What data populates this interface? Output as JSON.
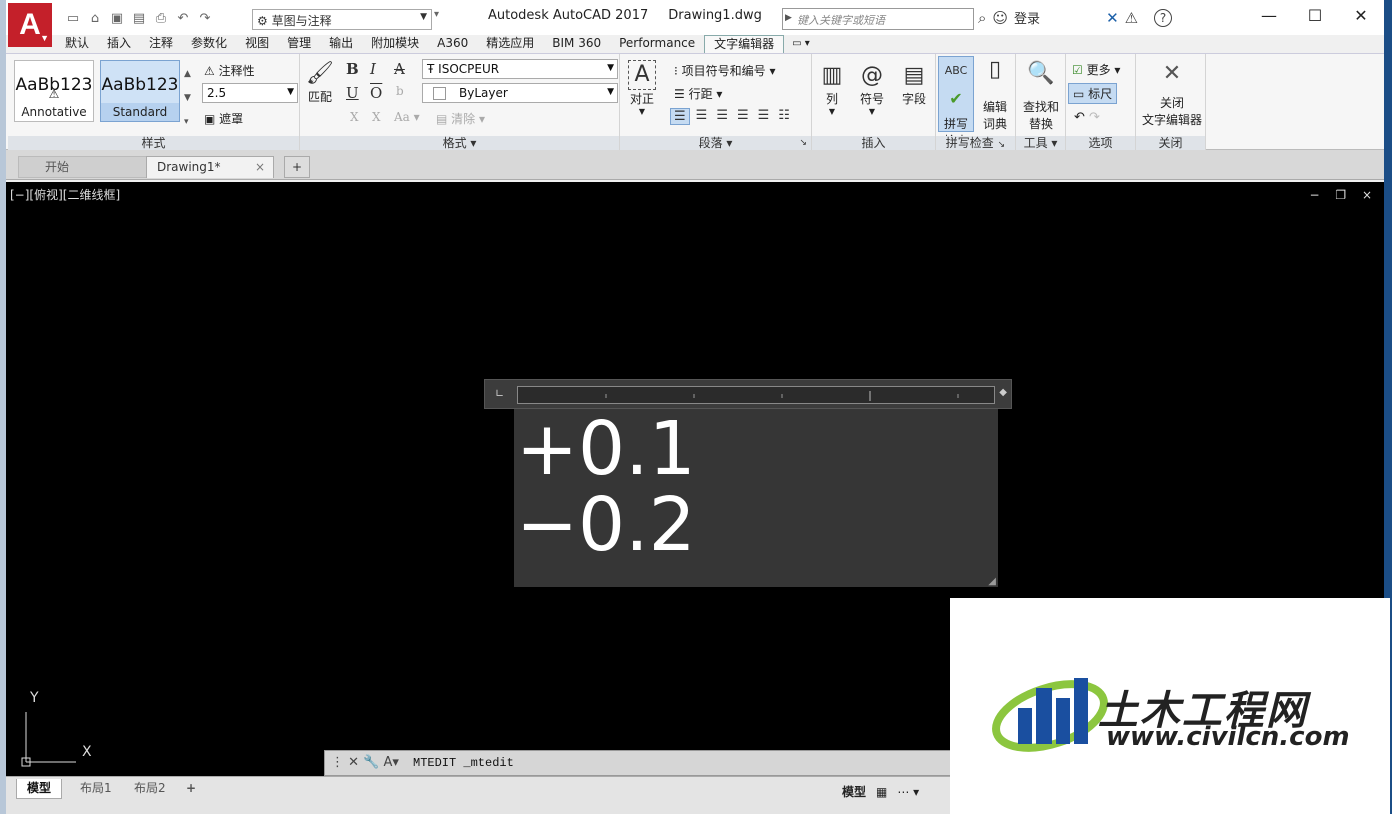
{
  "titlebar": {
    "app_logo": "A",
    "workspace": "草图与注释",
    "app_name": "Autodesk AutoCAD 2017",
    "file_name": "Drawing1.dwg",
    "search_placeholder": "键入关键字或短语",
    "login": "登录",
    "help": "?"
  },
  "ribbon_tabs": [
    "默认",
    "插入",
    "注释",
    "参数化",
    "视图",
    "管理",
    "输出",
    "附加模块",
    "A360",
    "精选应用",
    "BIM 360",
    "Performance",
    "文字编辑器"
  ],
  "active_tab": "文字编辑器",
  "ribbon": {
    "style": {
      "title": "样式",
      "annotative_sample": "AaBb123",
      "annotative_label": "Annotative",
      "standard_sample": "AaBb123",
      "standard_label": "Standard",
      "annotative_toggle": "注释性",
      "text_height": "2.5",
      "mask": "遮罩"
    },
    "format": {
      "title": "格式",
      "match": "匹配",
      "bold": "B",
      "italic": "I",
      "strike": "A",
      "underline": "U",
      "overline": "O",
      "stack": "b",
      "superscript": "X",
      "subscript": "X",
      "case": "Aa",
      "font": "ISOCPEUR",
      "color": "ByLayer",
      "clear": "清除"
    },
    "paragraph": {
      "title": "段落",
      "justify": "对正",
      "bullets": "项目符号和编号",
      "line_spacing": "行距"
    },
    "insert": {
      "title": "插入",
      "columns": "列",
      "symbol": "符号",
      "field": "字段"
    },
    "spell": {
      "title": "拼写检查",
      "check_1": "拼写",
      "check_2": "检查",
      "dict_1": "编辑",
      "dict_2": "词典"
    },
    "tools": {
      "title": "工具",
      "find_1": "查找和",
      "find_2": "替换"
    },
    "options": {
      "title": "选项",
      "more": "更多",
      "ruler": "标尺"
    },
    "close": {
      "title": "关闭",
      "close_1": "关闭",
      "close_2": "文字编辑器"
    }
  },
  "doc_tabs": {
    "start": "开始",
    "current": "Drawing1*",
    "close": "×",
    "new": "+"
  },
  "viewport": {
    "label": "[−][俯视][二维线框]",
    "controls": "− ❐ ×"
  },
  "mtext_lines": [
    "+0.1",
    "−0.2"
  ],
  "ucs": {
    "y": "Y",
    "x": "X"
  },
  "command_line": {
    "text": "MTEDIT _mtedit"
  },
  "layout_tabs": [
    "模型",
    "布局1",
    "布局2"
  ],
  "layout_add": "+",
  "status": {
    "model": "模型"
  },
  "watermark": {
    "title": "土木工程网",
    "url": "www.civilcn.com"
  },
  "colors": {
    "accent_red": "#c4202a",
    "canvas": "#000000",
    "editor_bg": "#363636",
    "watermark_blue": "#1a4fa0",
    "watermark_green": "#8cc63f"
  }
}
